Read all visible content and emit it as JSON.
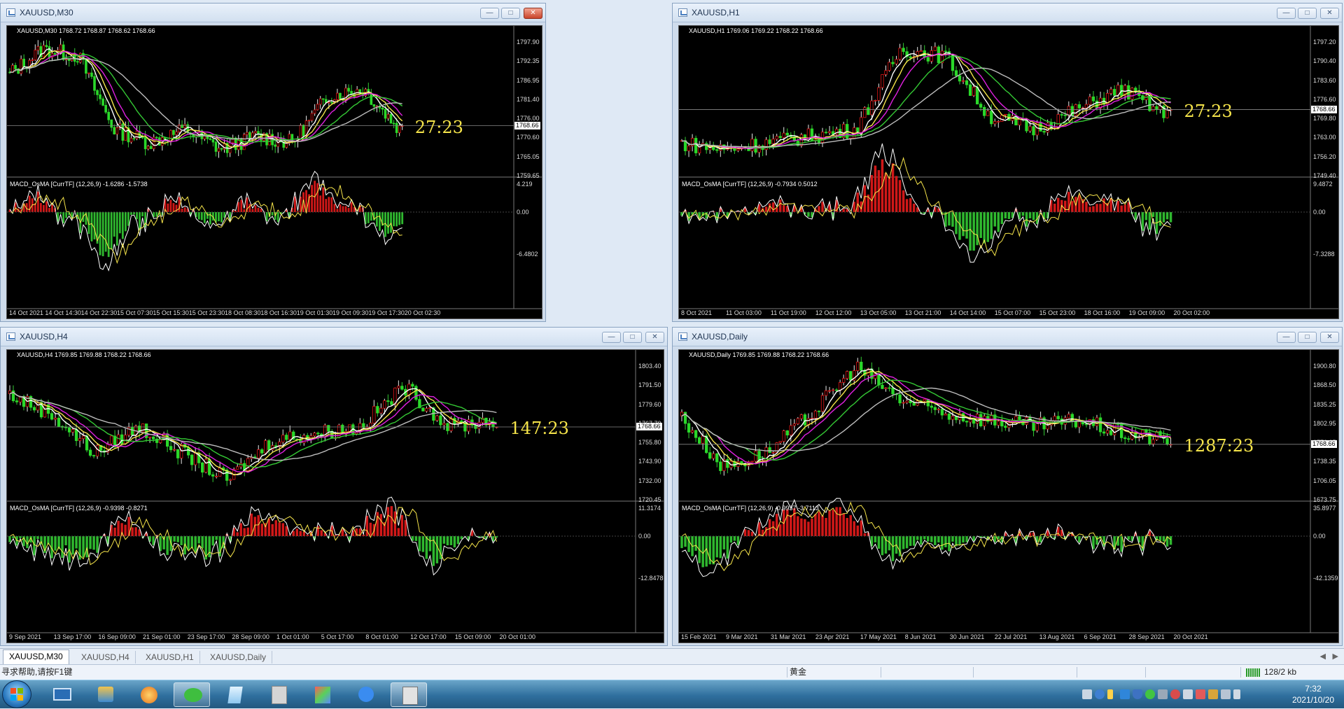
{
  "windows": [
    {
      "id": "m30",
      "title": "XAUUSD,M30",
      "header": "XAUUSD,M30  1768.72 1768.87 1768.62 1768.66",
      "price_scale": [
        "1797.90",
        "1792.35",
        "1786.95",
        "1781.40",
        "1776.00",
        "1770.60",
        "1765.05",
        "1759.65"
      ],
      "current_price": "1768.66",
      "timer": "27:23",
      "macd_label": "MACD_OsMA [CurrTF] (12,26,9) -1.6286 -1.5738",
      "macd_scale": [
        "4.219",
        "0.00",
        "-6.4802"
      ],
      "time_axis": [
        "14 Oct 2021",
        "14 Oct 14:30",
        "14 Oct 22:30",
        "15 Oct 07:30",
        "15 Oct 15:30",
        "15 Oct 23:30",
        "18 Oct 08:30",
        "18 Oct 16:30",
        "19 Oct 01:30",
        "19 Oct 09:30",
        "19 Oct 17:30",
        "20 Oct 02:30"
      ],
      "has_close_highlight": true
    },
    {
      "id": "h1",
      "title": "XAUUSD,H1",
      "header": "XAUUSD,H1  1769.06 1769.22 1768.22 1768.66",
      "price_scale": [
        "1797.20",
        "1790.40",
        "1783.60",
        "1776.60",
        "1769.80",
        "1763.00",
        "1756.20",
        "1749.40"
      ],
      "current_price": "1768.66",
      "timer": "27:23",
      "macd_label": "MACD_OsMA [CurrTF] (12,26,9) -0.7934 0.5012",
      "macd_scale": [
        "9.4872",
        "0.00",
        "-7.3288"
      ],
      "time_axis": [
        "8 Oct 2021",
        "11 Oct 03:00",
        "11 Oct 19:00",
        "12 Oct 12:00",
        "13 Oct 05:00",
        "13 Oct 21:00",
        "14 Oct 14:00",
        "15 Oct 07:00",
        "15 Oct 23:00",
        "18 Oct 16:00",
        "19 Oct 09:00",
        "20 Oct 02:00"
      ],
      "has_close_highlight": false
    },
    {
      "id": "h4",
      "title": "XAUUSD,H4",
      "header": "XAUUSD,H4  1769.85 1769.88 1768.22 1768.66",
      "price_scale": [
        "1803.40",
        "1791.50",
        "1779.60",
        "1767.70",
        "1755.80",
        "1743.90",
        "1732.00",
        "1720.45"
      ],
      "current_price": "1768.66",
      "timer": "147:23",
      "macd_label": "MACD_OsMA [CurrTF] (12,26,9) -0.9398 -0.8271",
      "macd_scale": [
        "11.3174",
        "0.00",
        "-12.8478"
      ],
      "time_axis": [
        "9 Sep 2021",
        "13 Sep 17:00",
        "16 Sep 09:00",
        "21 Sep 01:00",
        "23 Sep 17:00",
        "28 Sep 09:00",
        "1 Oct 01:00",
        "5 Oct 17:00",
        "8 Oct 01:00",
        "12 Oct 17:00",
        "15 Oct 09:00",
        "20 Oct 01:00"
      ],
      "has_close_highlight": false
    },
    {
      "id": "d1",
      "title": "XAUUSD,Daily",
      "header": "XAUUSD,Daily  1769.85 1769.88 1768.22 1768.66",
      "price_scale": [
        "1900.80",
        "1868.50",
        "1835.25",
        "1802.95",
        "1770.65",
        "1738.35",
        "1706.05",
        "1673.75"
      ],
      "current_price": "1768.66",
      "timer": "1287:23",
      "macd_label": "MACD_OsMA [CurrTF] (12,26,9) -0.9937 -3.7113",
      "macd_scale": [
        "35.8977",
        "0.00",
        "-42.1359"
      ],
      "time_axis": [
        "15 Feb 2021",
        "9 Mar 2021",
        "31 Mar 2021",
        "23 Apr 2021",
        "17 May 2021",
        "8 Jun 2021",
        "30 Jun 2021",
        "22 Jul 2021",
        "13 Aug 2021",
        "6 Sep 2021",
        "28 Sep 2021",
        "20 Oct 2021"
      ],
      "has_close_highlight": false
    }
  ],
  "tabs": [
    "XAUUSD,M30",
    "XAUUSD,H4",
    "XAUUSD,H1",
    "XAUUSD,Daily"
  ],
  "active_tab": "XAUUSD,M30",
  "status": {
    "help": "寻求帮助,请按F1键",
    "profile": "黄金",
    "connection": "128/2 kb"
  },
  "clock": {
    "time": "7:32",
    "date": "2021/10/20"
  },
  "colors": {
    "bull_hist": "#d01818",
    "bear_hist": "#2fb82f",
    "ma_fast": "#ffffff",
    "ma_yellow": "#f5e44a",
    "ma_magenta": "#e020e0",
    "ma_green": "#34c834",
    "ma_slow": "#bcbcbc",
    "timer": "#f5e44a"
  }
}
